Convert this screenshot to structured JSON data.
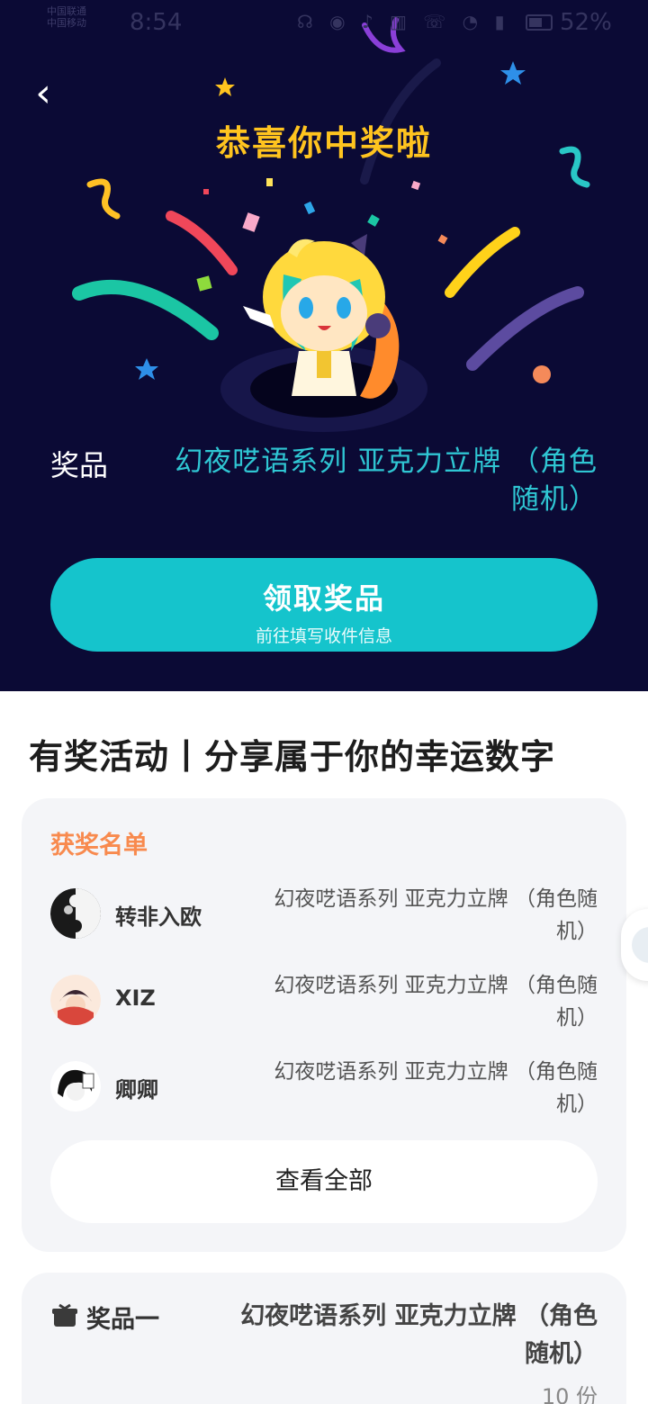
{
  "status_bar": {
    "carrier_line1": "中国联通",
    "carrier_line2": "中国移动",
    "time": "8:54",
    "icons": "☊ ◉ ♪ ▥ ☏ ◔ ▮",
    "battery": "52%"
  },
  "hero": {
    "back_icon": "chevron-left-icon",
    "title": "恭喜你中奖啦",
    "prize_label": "奖品",
    "prize_name": "幻夜呓语系列 亚克力立牌 （角色随机）",
    "claim_button": {
      "label": "领取奖品",
      "sublabel": "前往填写收件信息"
    }
  },
  "activity": {
    "title": "有奖活动丨分享属于你的幸运数字"
  },
  "winners": {
    "heading": "获奖名单",
    "rows": [
      {
        "name": "转非入欧",
        "prize": "幻夜呓语系列 亚克力立牌 （角色随机）"
      },
      {
        "name": "XIZ",
        "prize": "幻夜呓语系列 亚克力立牌 （角色随机）"
      },
      {
        "name": "卿卿",
        "prize": "幻夜呓语系列 亚克力立牌 （角色随机）"
      }
    ],
    "view_all": "查看全部"
  },
  "prize_card": {
    "label": "奖品一",
    "name": "幻夜呓语系列 亚克力立牌 （角色随机）",
    "quantity": "10 份"
  },
  "colors": {
    "hero_bg": "#0b0a35",
    "title_yellow": "#ffc41f",
    "accent_teal": "#15c4cc",
    "winner_heading": "#f88a4e"
  }
}
